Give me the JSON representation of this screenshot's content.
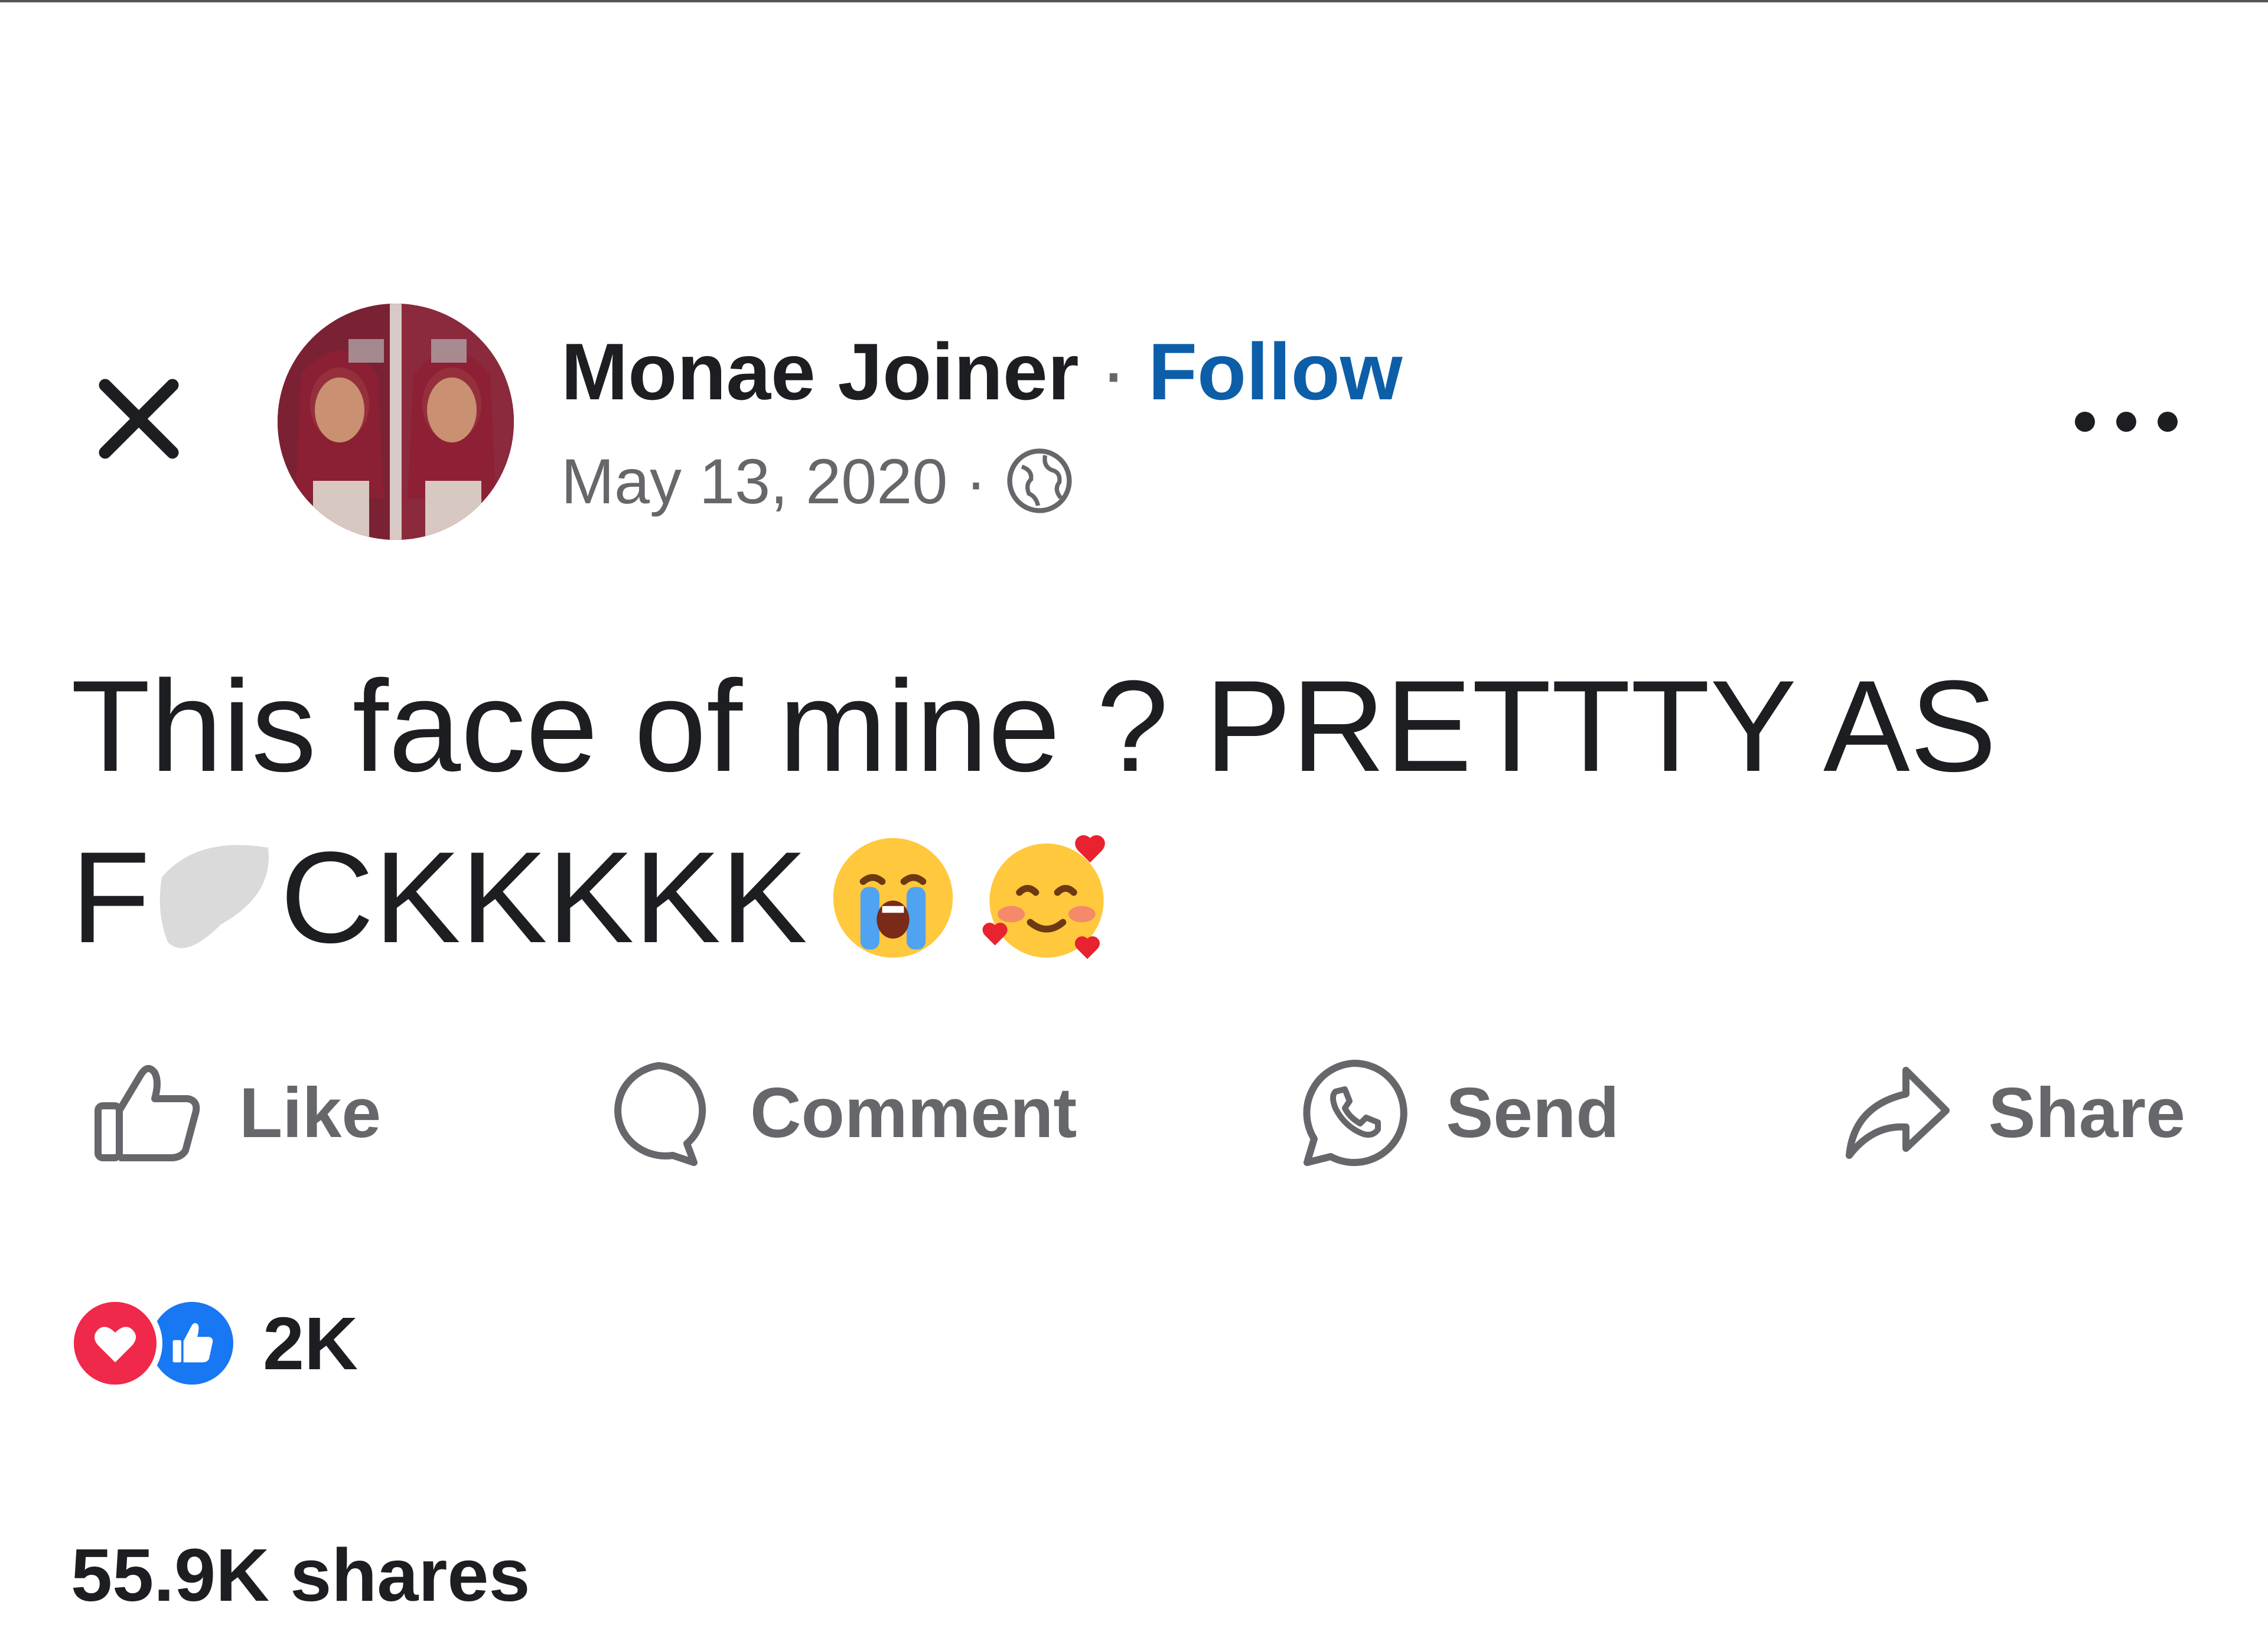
{
  "post": {
    "author": "Monae Joiner",
    "separator": "·",
    "follow_label": "Follow",
    "date": "May 13, 2020",
    "audience_icon": "globe-icon",
    "text_line1": "This face of mine ? PRETTTY AS",
    "text_line2_start": "F",
    "text_line2_end": "CKKKKK",
    "emojis": [
      "loudly-crying-face-emoji",
      "smiling-face-with-hearts-emoji"
    ]
  },
  "actions": {
    "like": "Like",
    "comment": "Comment",
    "send": "Send",
    "share": "Share"
  },
  "reactions": {
    "icons": [
      "heart-icon",
      "thumbs-up-icon"
    ],
    "count": "2K"
  },
  "shares": "55.9K shares",
  "colors": {
    "follow": "#0d5ea8",
    "text": "#1c1e21",
    "secondary": "#65676b",
    "heart": "#f0284a",
    "like": "#1877f2"
  }
}
